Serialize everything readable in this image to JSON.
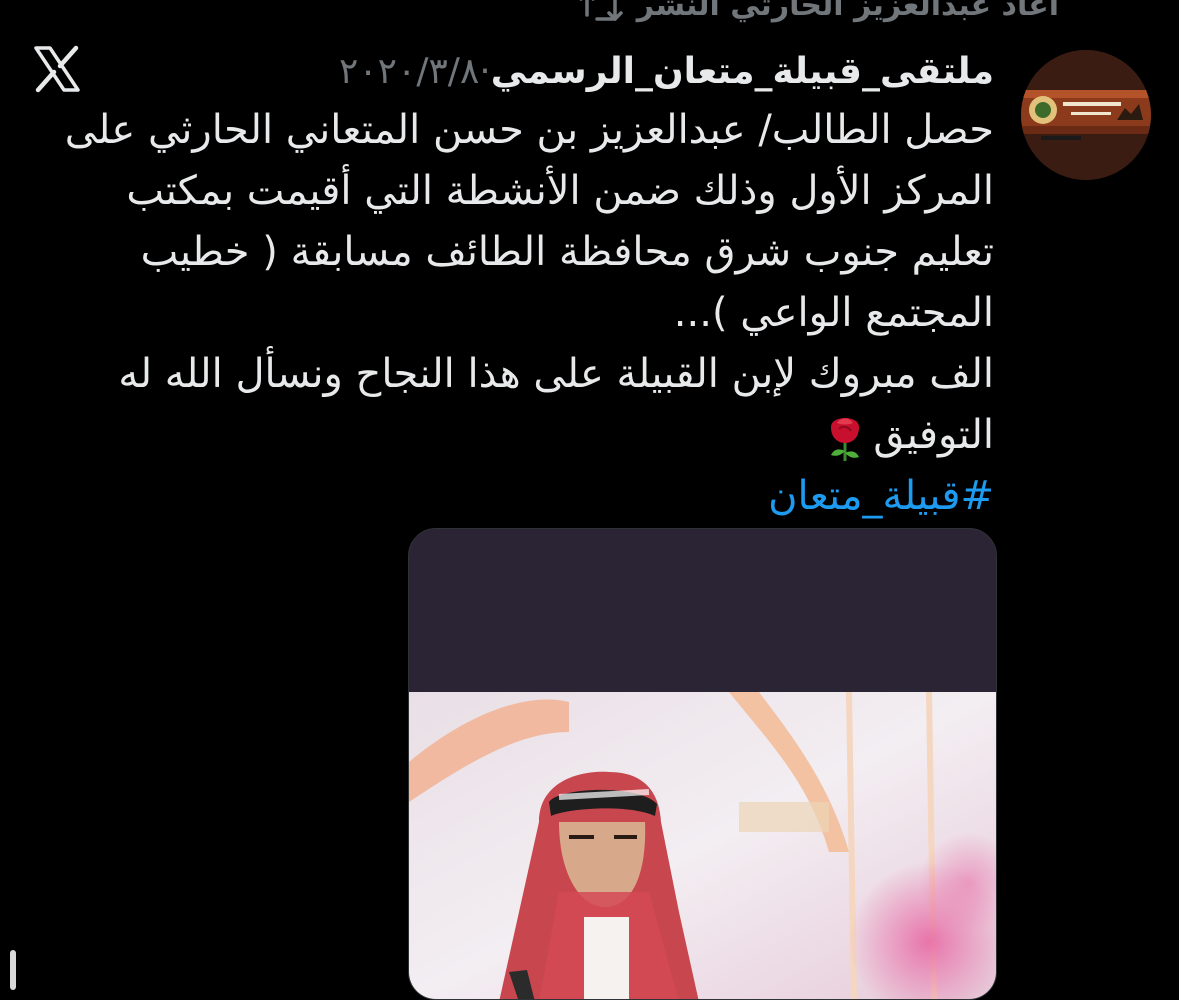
{
  "retweet": {
    "icon": "retweet-icon",
    "text": "أعاد عبدالعزيز الحارثي النشر"
  },
  "app": {
    "logo": "x-logo-icon"
  },
  "tweet": {
    "author": "ملتقى_قبيلة_متعان_الرسمي",
    "separator": "·",
    "date": "٢٠٢٠/٣/٨",
    "paragraph1": "حصل الطالب/ عبدالعزيز بن حسن المتعاني الحارثي على المركز الأول وذلك ضمن الأنشطة التي أقيمت بمكتب تعليم جنوب شرق محافظة الطائف مسابقة ( خطيب المجتمع الواعي )...",
    "paragraph2": "الف مبروك لإبن القبيلة على هذا النجاح ونسأل الله له التوفيق",
    "emoji": "rose-icon",
    "hashtag": "#قبيلة_متعان"
  },
  "colors": {
    "background": "#000000",
    "text": "#e7e9ea",
    "muted": "#71767b",
    "link": "#1d9bf0"
  }
}
